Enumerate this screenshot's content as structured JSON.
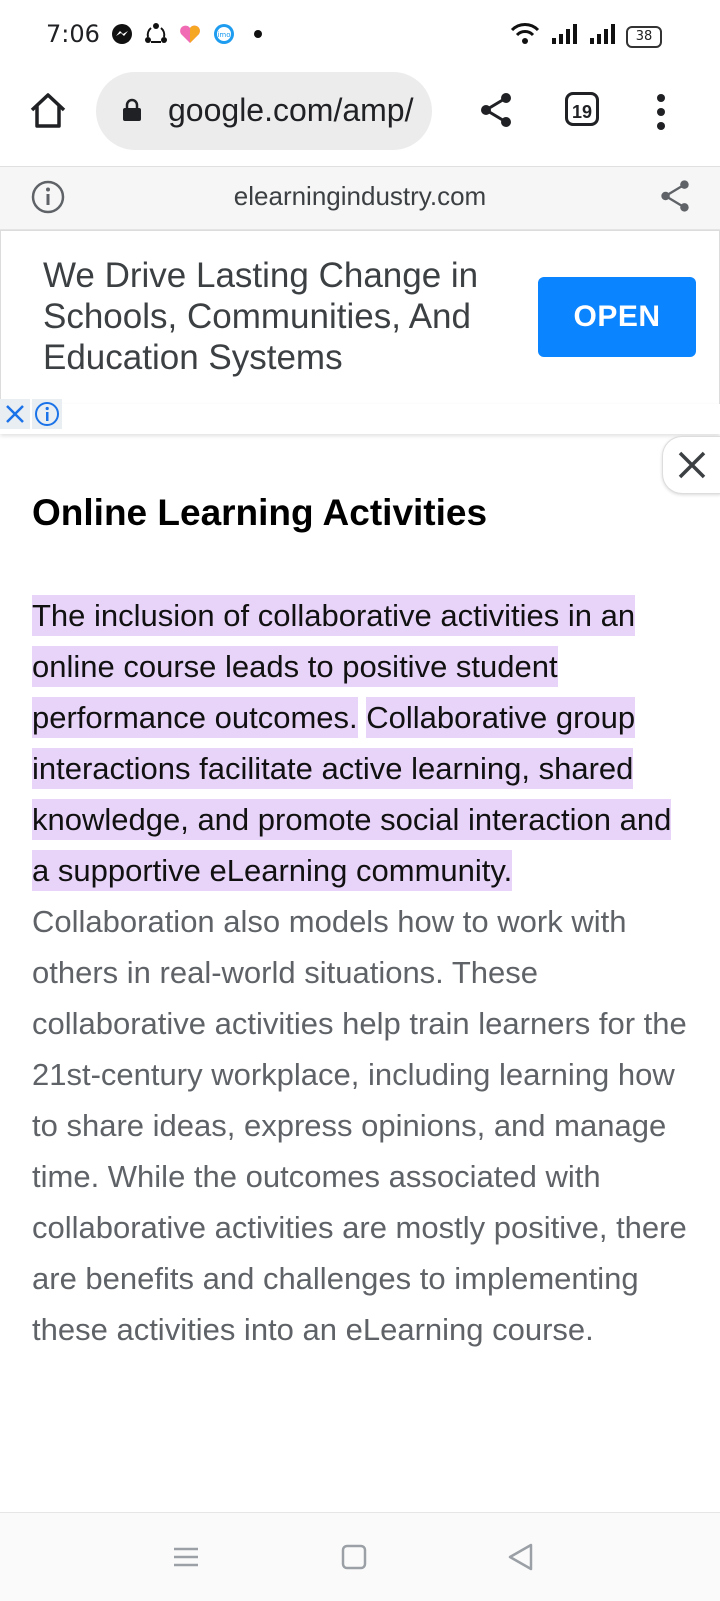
{
  "status_bar": {
    "time": "7:06",
    "battery": "38",
    "notification_icons": [
      "messenger-icon",
      "sync-icon",
      "heart-icon",
      "imo-icon",
      "dot-icon"
    ]
  },
  "toolbar": {
    "url": "google.com/amp/",
    "tab_count": "19"
  },
  "amp_header": {
    "domain": "elearningindustry.com"
  },
  "ad": {
    "text": "We Drive Lasting Change in Schools, Communities, And Education Systems",
    "button_label": "OPEN",
    "button_color": "#0a84ff"
  },
  "article": {
    "heading": "Online Learning Activities",
    "highlighted_1": "The inclusion of collaborative activities in an online course leads to positive student performance outcomes.",
    "highlighted_2": "Collaborative group interactions facilitate active learning, shared knowledge, and promote social interaction and a supportive eLearning community.",
    "rest": "Collaboration also models how to work with others in real-world situations. These collaborative activities help train learners for the 21st-century workplace, including learning how to share ideas, express opinions, and manage time. While the outcomes associated with collaborative activities are mostly positive, there are benefits and challenges to implementing these activities into an eLearning course.",
    "highlight_color": "#e8d4f8"
  }
}
